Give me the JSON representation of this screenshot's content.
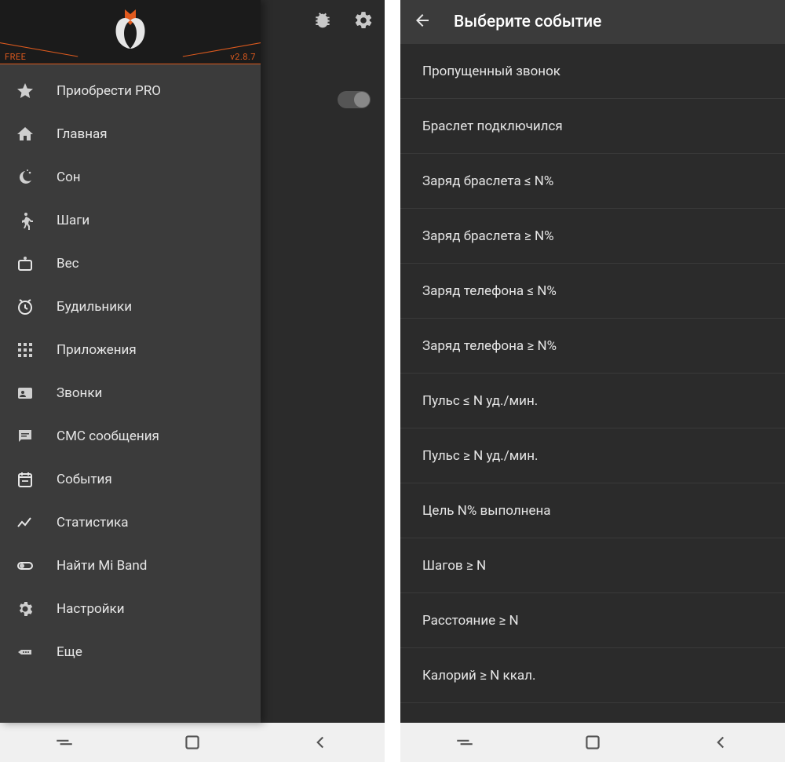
{
  "left": {
    "free_tag": "FREE",
    "version": "v2.8.7",
    "menu": [
      {
        "icon": "star",
        "label": "Приобрести PRO"
      },
      {
        "icon": "home",
        "label": "Главная"
      },
      {
        "icon": "moon",
        "label": "Сон"
      },
      {
        "icon": "walk",
        "label": "Шаги"
      },
      {
        "icon": "scale",
        "label": "Вес"
      },
      {
        "icon": "alarm",
        "label": "Будильники"
      },
      {
        "icon": "apps",
        "label": "Приложения"
      },
      {
        "icon": "contact",
        "label": "Звонки"
      },
      {
        "icon": "sms",
        "label": "СМС сообщения"
      },
      {
        "icon": "event",
        "label": "События"
      },
      {
        "icon": "chart",
        "label": "Статистика"
      },
      {
        "icon": "toggle",
        "label": "Найти Mi Band"
      },
      {
        "icon": "gear",
        "label": "Настройки"
      },
      {
        "icon": "more",
        "label": "Еще"
      }
    ]
  },
  "right": {
    "title": "Выберите событие",
    "events": [
      "Пропущенный звонок",
      "Браслет подключился",
      "Заряд браслета ≤ N%",
      "Заряд браслета ≥ N%",
      "Заряд телефона ≤ N%",
      "Заряд телефона ≥ N%",
      "Пульс ≤ N уд./мин.",
      "Пульс ≥ N уд./мин.",
      "Цель N% выполнена",
      "Шагов ≥ N",
      "Расстояние ≥ N",
      "Калорий ≥ N ккал."
    ]
  }
}
